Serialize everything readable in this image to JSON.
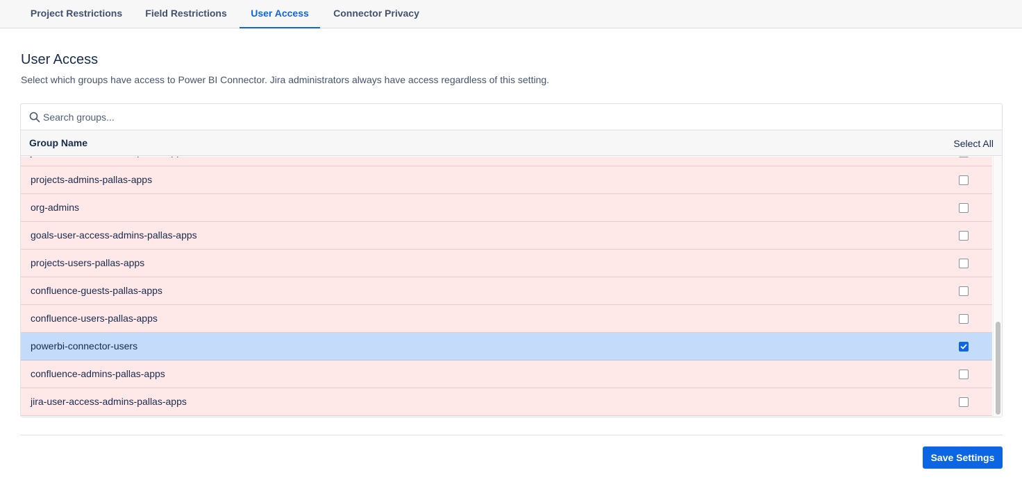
{
  "tabs": [
    {
      "label": "Project Restrictions",
      "active": false
    },
    {
      "label": "Field Restrictions",
      "active": false
    },
    {
      "label": "User Access",
      "active": true
    },
    {
      "label": "Connector Privacy",
      "active": false
    }
  ],
  "page": {
    "title": "User Access",
    "description": "Select which groups have access to Power BI Connector. Jira administrators always have access regardless of this setting."
  },
  "search": {
    "placeholder": "Search groups...",
    "value": "",
    "icon": "search-icon"
  },
  "table": {
    "column_name": "Group Name",
    "select_all_label": "Select All",
    "rows": [
      {
        "name": "jira-user-access-admins-pallas-apps",
        "checked": false
      },
      {
        "name": "projects-admins-pallas-apps",
        "checked": false
      },
      {
        "name": "org-admins",
        "checked": false
      },
      {
        "name": "goals-user-access-admins-pallas-apps",
        "checked": false
      },
      {
        "name": "projects-users-pallas-apps",
        "checked": false
      },
      {
        "name": "confluence-guests-pallas-apps",
        "checked": false
      },
      {
        "name": "confluence-users-pallas-apps",
        "checked": false
      },
      {
        "name": "powerbi-connector-users",
        "checked": true
      },
      {
        "name": "confluence-admins-pallas-apps",
        "checked": false
      },
      {
        "name": "jira-user-access-admins-pallas-apps",
        "checked": false
      }
    ]
  },
  "actions": {
    "save_label": "Save Settings"
  },
  "colors": {
    "accent": "#0c66e4",
    "row_unselected": "#ffe8e8",
    "row_selected": "#c4dbf9"
  }
}
